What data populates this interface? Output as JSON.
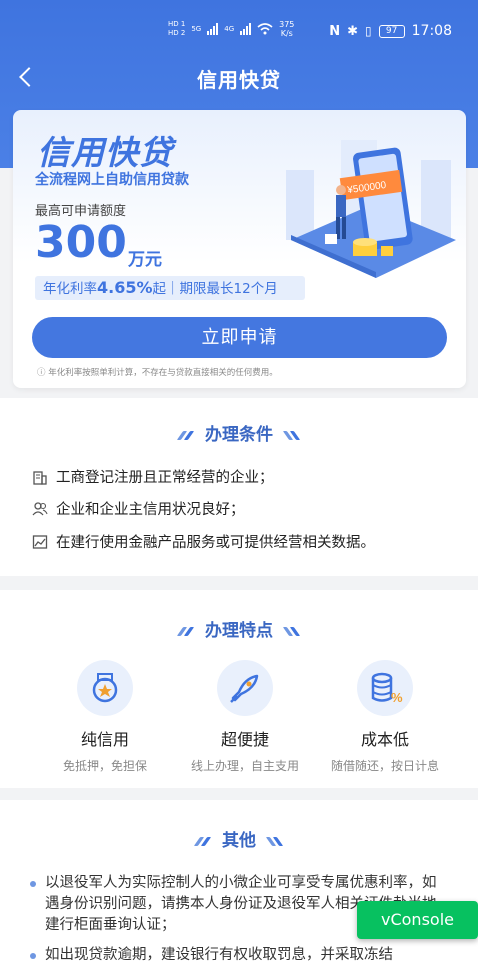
{
  "status_bar": {
    "hd1": "HD 1",
    "hd2": "HD 2",
    "net1": "5G",
    "net2": "4G",
    "speed_value": "375",
    "speed_unit": "K/s",
    "battery": "97",
    "time": "17:08"
  },
  "nav": {
    "title": "信用快贷"
  },
  "hero": {
    "brand": "信用快贷",
    "subtitle": "全流程网上自助信用贷款",
    "amount_label": "最高可申请额度",
    "amount": "300",
    "amount_unit": "万元",
    "rate_prefix": "年化利率",
    "rate_value": "4.65%",
    "rate_suffix": "起｜期限最长12个月",
    "apply_button": "立即申请",
    "disclaimer": "年化利率按照单利计算，不存在与贷款直接相关的任何费用。",
    "illustration_amount": "¥500000"
  },
  "conditions": {
    "title": "办理条件",
    "items": [
      {
        "icon": "building-icon",
        "text": "工商登记注册且正常经营的企业；"
      },
      {
        "icon": "users-icon",
        "text": "企业和企业主信用状况良好；"
      },
      {
        "icon": "chart-icon",
        "text": "在建行使用金融产品服务或可提供经营相关数据。"
      }
    ]
  },
  "features": {
    "title": "办理特点",
    "items": [
      {
        "icon": "medal-icon",
        "name": "纯信用",
        "desc": "免抵押，免担保"
      },
      {
        "icon": "rocket-icon",
        "name": "超便捷",
        "desc": "线上办理，自主支用"
      },
      {
        "icon": "coins-icon",
        "name": "成本低",
        "desc": "随借随还，按日计息"
      }
    ]
  },
  "other": {
    "title": "其他",
    "items": [
      "以退役军人为实际控制人的小微企业可享受专属优惠利率，如遇身份识别问题，请携本人身份证及退役军人相关证件赴当地建行柜面垂询认证；",
      "如出现贷款逾期，建设银行有权收取罚息，并采取冻结"
    ]
  },
  "vconsole": "vConsole",
  "colors": {
    "primary": "#3f74df",
    "vconsole": "#07c160"
  }
}
